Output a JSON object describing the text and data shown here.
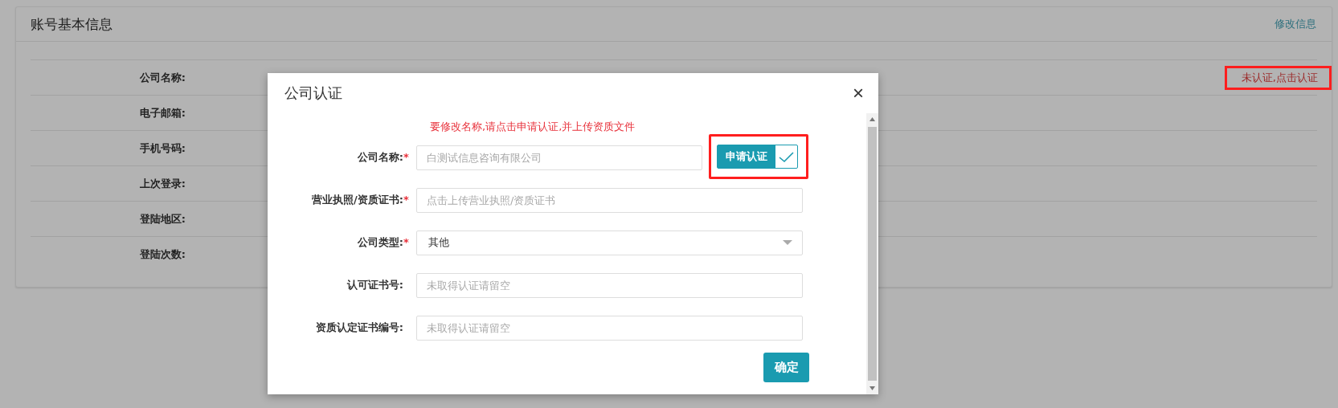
{
  "account": {
    "title": "账号基本信息",
    "edit_link": "修改信息",
    "fields": [
      {
        "label": "公司名称:",
        "status": {
          "text": "未认证,点击认证",
          "highlighted": true
        }
      },
      {
        "label": "电子邮箱:"
      },
      {
        "label": "手机号码:"
      },
      {
        "label": "上次登录:"
      },
      {
        "label": "登陆地区:"
      },
      {
        "label": "登陆次数:"
      }
    ]
  },
  "dialog": {
    "title": "公司认证",
    "close": "×",
    "notice": "要修改名称,请点击申请认证,并上传资质文件",
    "fields": [
      {
        "kind": "text",
        "label": "公司名称:",
        "required_mark": "*",
        "placeholder": "白测试信息咨询有限公司",
        "action": {
          "label": "申请认证",
          "highlighted": true
        }
      },
      {
        "kind": "text",
        "label": "营业执照/资质证书:",
        "required_mark": "*",
        "placeholder": "点击上传营业执照/资质证书"
      },
      {
        "kind": "select",
        "label": "公司类型:",
        "required_mark": "*",
        "value": "其他"
      },
      {
        "kind": "text",
        "label": "认可证书号:",
        "placeholder": "未取得认证请留空"
      },
      {
        "kind": "text",
        "label": "资质认定证书编号:",
        "placeholder": "未取得认证请留空"
      }
    ],
    "confirm": "确定"
  }
}
